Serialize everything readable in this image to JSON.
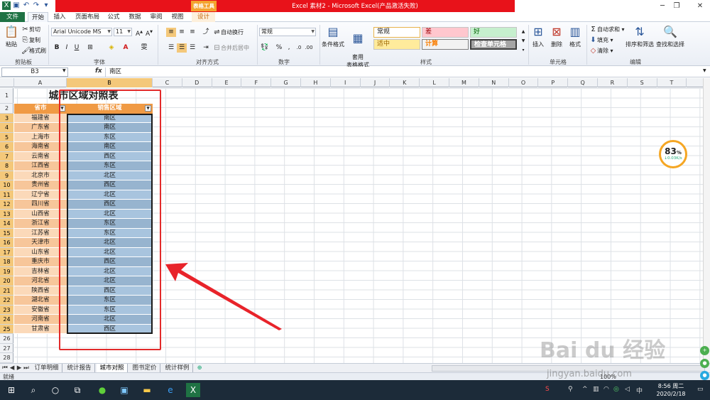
{
  "window": {
    "title": "Excel 素材2 - Microsoft Excel(产品激活失败)",
    "context_tab": "表格工具",
    "accent_color": "#e8121a"
  },
  "tabs": [
    "文件",
    "开始",
    "插入",
    "页面布局",
    "公式",
    "数据",
    "审阅",
    "视图",
    "设计"
  ],
  "ribbon": {
    "clipboard": {
      "paste": "粘贴",
      "cut": "剪切",
      "copy": "复制",
      "format_painter": "格式刷",
      "label": "剪贴板"
    },
    "font": {
      "name": "Arial Unicode MS",
      "size": "11",
      "label": "字体"
    },
    "alignment": {
      "wrap": "自动换行",
      "merge": "合并后居中",
      "label": "对齐方式"
    },
    "number": {
      "format": "常规",
      "label": "数字"
    },
    "styles": {
      "cond_format": "条件格式",
      "table_format": "套用\n表格格式",
      "normal": "常规",
      "bad": "差",
      "good": "好",
      "neutral": "适中",
      "calculation": "计算",
      "check_cell": "检查单元格",
      "label": "样式"
    },
    "cells": {
      "insert": "插入",
      "delete": "删除",
      "format": "格式",
      "label": "单元格"
    },
    "editing": {
      "autosum": "自动求和",
      "fill": "填充",
      "clear": "清除",
      "sort_filter": "排序和筛选",
      "find_select": "查找和选择",
      "label": "编辑"
    }
  },
  "formula_bar": {
    "name_box": "B3",
    "fx": "fx",
    "value": "南区"
  },
  "columns": [
    "A",
    "B",
    "C",
    "D",
    "E",
    "F",
    "G",
    "H",
    "I",
    "J",
    "K",
    "L",
    "M",
    "N",
    "O",
    "P",
    "Q",
    "R",
    "S",
    "T"
  ],
  "rows": [
    "1",
    "2",
    "3",
    "4",
    "5",
    "6",
    "7",
    "8",
    "9",
    "10",
    "11",
    "12",
    "13",
    "14",
    "15",
    "16",
    "17",
    "18",
    "19",
    "20",
    "21",
    "22",
    "23",
    "24",
    "25",
    "26",
    "27",
    "28"
  ],
  "sheet": {
    "title": "城市区域对照表",
    "header": [
      "省市",
      "销售区域"
    ],
    "data": [
      [
        "福建省",
        "南区"
      ],
      [
        "广东省",
        "南区"
      ],
      [
        "上海市",
        "东区"
      ],
      [
        "海南省",
        "南区"
      ],
      [
        "云南省",
        "西区"
      ],
      [
        "江西省",
        "东区"
      ],
      [
        "北京市",
        "北区"
      ],
      [
        "贵州省",
        "西区"
      ],
      [
        "辽宁省",
        "北区"
      ],
      [
        "四川省",
        "西区"
      ],
      [
        "山西省",
        "北区"
      ],
      [
        "浙江省",
        "东区"
      ],
      [
        "江苏省",
        "东区"
      ],
      [
        "天津市",
        "北区"
      ],
      [
        "山东省",
        "北区"
      ],
      [
        "重庆市",
        "西区"
      ],
      [
        "吉林省",
        "北区"
      ],
      [
        "河北省",
        "北区"
      ],
      [
        "陕西省",
        "西区"
      ],
      [
        "湖北省",
        "东区"
      ],
      [
        "安徽省",
        "东区"
      ],
      [
        "河南省",
        "北区"
      ],
      [
        "甘肃省",
        "西区"
      ]
    ],
    "colors": {
      "header": "#f09a44",
      "rowA_light": "#fbd9b9",
      "rowA_dark": "#f7c69a",
      "rowB_light": "#a8c4de",
      "rowB_dark": "#97b4cf"
    }
  },
  "sheet_tabs": [
    "订单明细",
    "统计报告",
    "城市对照",
    "图书定价",
    "统计样例"
  ],
  "status": {
    "ready": "就绪",
    "zoom": "100%"
  },
  "speed_widget": {
    "percent": "83",
    "unit": "%",
    "rate": "↓0.03K/s"
  },
  "taskbar": {
    "time": "8:56 周二",
    "date": "2020/2/18"
  },
  "watermark": {
    "brand": "Bai du 经验",
    "url": "jingyan.baidu.com"
  }
}
